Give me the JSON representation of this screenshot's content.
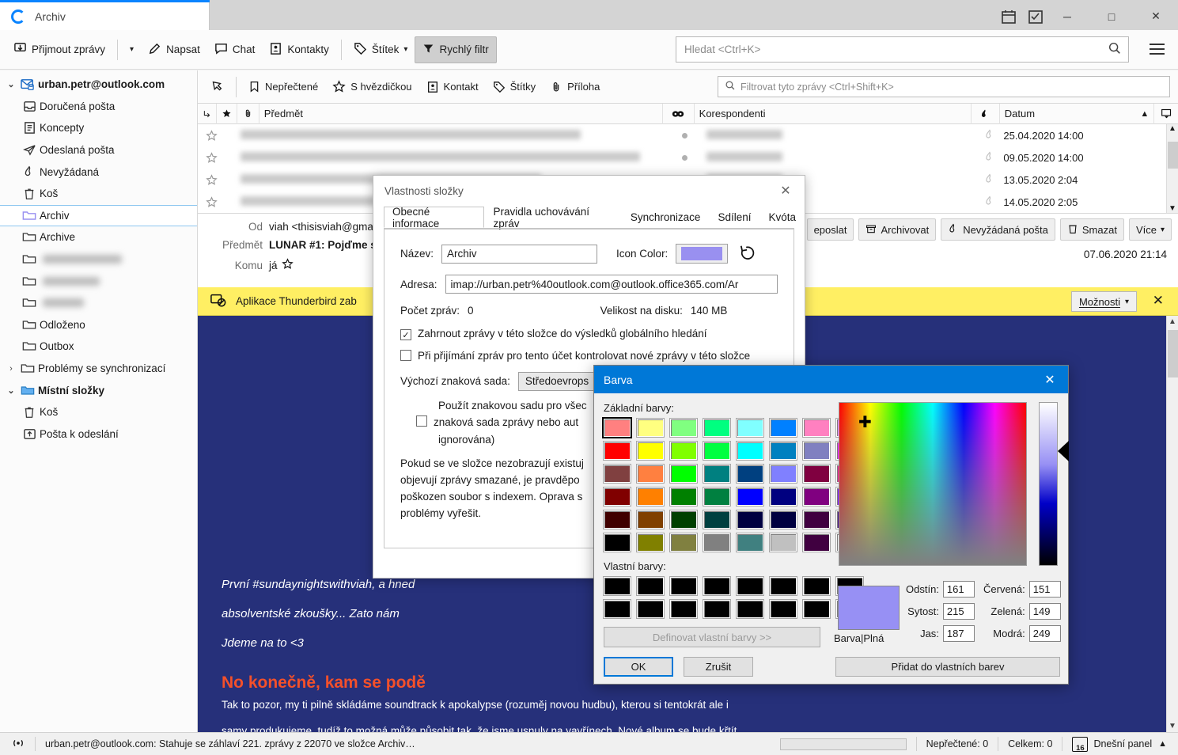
{
  "window": {
    "tab_title": "Archiv",
    "minimize": "─",
    "maximize": "□",
    "close": "✕"
  },
  "toolbar": {
    "get_messages": "Přijmout zprávy",
    "write": "Napsat",
    "chat": "Chat",
    "contacts": "Kontakty",
    "tag": "Štítek",
    "quick_filter": "Rychlý filtr",
    "search_placeholder": "Hledat <Ctrl+K>"
  },
  "sidebar": {
    "items": [
      {
        "label": "urban.petr@outlook.com",
        "icon": "account-icon",
        "level": 0,
        "bold": true,
        "twisty": "⌄"
      },
      {
        "label": "Doručená pošta",
        "icon": "inbox-icon",
        "level": 1
      },
      {
        "label": "Koncepty",
        "icon": "drafts-icon",
        "level": 1
      },
      {
        "label": "Odeslaná pošta",
        "icon": "sent-icon",
        "level": 1
      },
      {
        "label": "Nevyžádaná",
        "icon": "junk-icon",
        "level": 1
      },
      {
        "label": "Koš",
        "icon": "trash-icon",
        "level": 1
      },
      {
        "label": "Archiv",
        "icon": "folder-icon",
        "level": 1,
        "selected": true
      },
      {
        "label": "Archive",
        "icon": "folder-icon",
        "level": 1
      },
      {
        "label": "",
        "icon": "folder-icon",
        "level": 1,
        "redacted": true,
        "redact_w": 100
      },
      {
        "label": "",
        "icon": "folder-icon",
        "level": 1,
        "redacted": true,
        "redact_w": 72
      },
      {
        "label": "",
        "icon": "folder-icon",
        "level": 1,
        "redacted": true,
        "redact_w": 52
      },
      {
        "label": "Odloženo",
        "icon": "folder-icon",
        "level": 1
      },
      {
        "label": "Outbox",
        "icon": "folder-icon",
        "level": 1
      },
      {
        "label": "Problémy se synchronizací",
        "icon": "folder-icon",
        "level": 1,
        "twisty": "›"
      },
      {
        "label": "Místní složky",
        "icon": "local-folder-icon",
        "level": 0,
        "bold": true,
        "twisty": "⌄"
      },
      {
        "label": "Koš",
        "icon": "trash-icon",
        "level": 1
      },
      {
        "label": "Pošta k odeslání",
        "icon": "outbox-icon",
        "level": 1
      }
    ]
  },
  "quick_filter_bar": {
    "unread": "Nepřečtené",
    "starred": "S hvězdičkou",
    "contact": "Kontakt",
    "tags": "Štítky",
    "attachment": "Příloha",
    "filter_placeholder": "Filtrovat tyto zprávy <Ctrl+Shift+K>"
  },
  "message_list": {
    "columns": [
      "",
      "★",
      "📎",
      "Předmět",
      "",
      "Korespondenti",
      "",
      "Datum"
    ],
    "subject_header": "Předmět",
    "correspondents_header": "Korespondenti",
    "date_header": "Datum",
    "rows": [
      {
        "subject": "",
        "correspondent": "",
        "date": "25.04.2020 14:00",
        "subject_w": 430,
        "corr_w": 96
      },
      {
        "subject": "",
        "correspondent": "",
        "date": "09.05.2020 14:00",
        "subject_w": 505,
        "corr_w": 96
      },
      {
        "subject": "",
        "correspondent": "",
        "date": "13.05.2020 2:04",
        "subject_w": 380,
        "corr_w": 96
      },
      {
        "subject": "",
        "correspondent": "",
        "date": "14.05.2020 2:05",
        "subject_w": 260,
        "corr_w": 96
      }
    ]
  },
  "message_header": {
    "from_label": "Od",
    "from_value": "viah <thisisviah@gmai",
    "subject_label": "Předmět",
    "subject_value": "LUNAR #1: Pojďme s",
    "to_label": "Komu",
    "to_value": "já",
    "date": "07.06.2020 21:14",
    "buttons": [
      "eposlat",
      "Archivovat",
      "Nevyžádaná pošta",
      "Smazat",
      "Více"
    ]
  },
  "notification": {
    "text": "Aplikace Thunderbird zab",
    "options_label": "Možnosti",
    "close": "✕"
  },
  "message_body": {
    "line1": "První #sundaynightswithviah, a hned",
    "line2": "absolventské zkoušky... Zato nám",
    "line3": "Jdeme na to <3",
    "heading": "No konečně, kam se podě",
    "para1": "Tak to pozor, my ti pilně skládáme soundtrack k apokalypse (rozuměj novou hudbu), kterou si tentokrát ale i",
    "para2": "samy produkujeme, tudíž to možná může působit tak, že jsme usnuly na vavřínech. Nové album se bude křtít"
  },
  "statusbar": {
    "status_text": "urban.petr@outlook.com: Stahuje se záhlaví 221. zprávy z 22070 ve složce Archiv…",
    "unread": "Nepřečtené: 0",
    "total": "Celkem: 0",
    "today_pane": "Dnešní panel",
    "calendar_day": "16"
  },
  "folder_properties": {
    "title": "Vlastnosti složky",
    "close": "✕",
    "tabs": [
      {
        "label": "Obecné informace",
        "active": true
      },
      {
        "label": "Pravidla uchovávání zpráv",
        "active": false
      },
      {
        "label": "Synchronizace",
        "active": false
      },
      {
        "label": "Sdílení",
        "active": false
      },
      {
        "label": "Kvóta",
        "active": false
      }
    ],
    "name_label": "Název:",
    "name_value": "Archiv",
    "icon_color_label": "Icon Color:",
    "icon_color": "#9990f0",
    "reset_icon": "reset-icon",
    "address_label": "Adresa:",
    "address_value": "imap://urban.petr%40outlook.com@outlook.office365.com/Ar",
    "count_label": "Počet zpráv:",
    "count_value": "0",
    "size_label": "Velikost na disku:",
    "size_value": "140 MB",
    "check_global_search": "Zahrnout zprávy v této složce do výsledků globálního hledání",
    "check_global_search_on": true,
    "check_new_messages": "Při přijímání zpráv pro tento účet kontrolovat nové zprávy v této složce",
    "check_new_messages_on": false,
    "charset_label": "Výchozí znaková sada:",
    "charset_value": "Středoevrops",
    "charset_override_line1": "Použít znakovou sadu pro všec",
    "charset_override_line2": "znaková sada zprávy nebo aut",
    "charset_override_line3": "ignorována)",
    "note_line1": "Pokud se ve složce nezobrazují existuj",
    "note_line2": "objevují zprávy smazané, je pravděpo",
    "note_line3": "poškozen soubor s indexem. Oprava s",
    "note_line4": "problémy vyřešit."
  },
  "color_dialog": {
    "title": "Barva",
    "close": "✕",
    "basic_colors_label": "Základní barvy:",
    "custom_colors_label": "Vlastní barvy:",
    "define_custom_label": "Definovat vlastní barvy >>",
    "ok_label": "OK",
    "cancel_label": "Zrušit",
    "add_custom_label": "Přidat do vlastních barev",
    "preview_label": "Barva|Plná",
    "preview_color": "#9790f4",
    "selected_index": 0,
    "fields": [
      {
        "label": "Odstín:",
        "value": "161"
      },
      {
        "label": "Sytost:",
        "value": "215"
      },
      {
        "label": "Jas:",
        "value": "187"
      },
      {
        "label": "Červená:",
        "value": "151"
      },
      {
        "label": "Zelená:",
        "value": "149"
      },
      {
        "label": "Modrá:",
        "value": "249"
      }
    ],
    "basic_colors": [
      "#ff8080",
      "#ffff80",
      "#80ff80",
      "#00ff80",
      "#80ffff",
      "#0080ff",
      "#ff80c0",
      "#ff80ff",
      "#ff0000",
      "#ffff00",
      "#80ff00",
      "#00ff40",
      "#00ffff",
      "#0080c0",
      "#8080c0",
      "#ff00ff",
      "#804040",
      "#ff8040",
      "#00ff00",
      "#008080",
      "#004080",
      "#8080ff",
      "#800040",
      "#ff0080",
      "#800000",
      "#ff8000",
      "#008000",
      "#008040",
      "#0000ff",
      "#000080",
      "#800080",
      "#8000ff",
      "#400000",
      "#804000",
      "#004000",
      "#004040",
      "#000040",
      "#000040",
      "#400040",
      "#400080",
      "#000000",
      "#808000",
      "#808040",
      "#808080",
      "#408080",
      "#c0c0c0",
      "#400040",
      "#ffffff"
    ],
    "custom_colors": [
      "#000000",
      "#000000",
      "#000000",
      "#000000",
      "#000000",
      "#000000",
      "#000000",
      "#000000",
      "#000000",
      "#000000",
      "#000000",
      "#000000",
      "#000000",
      "#000000",
      "#000000",
      "#000000"
    ]
  }
}
